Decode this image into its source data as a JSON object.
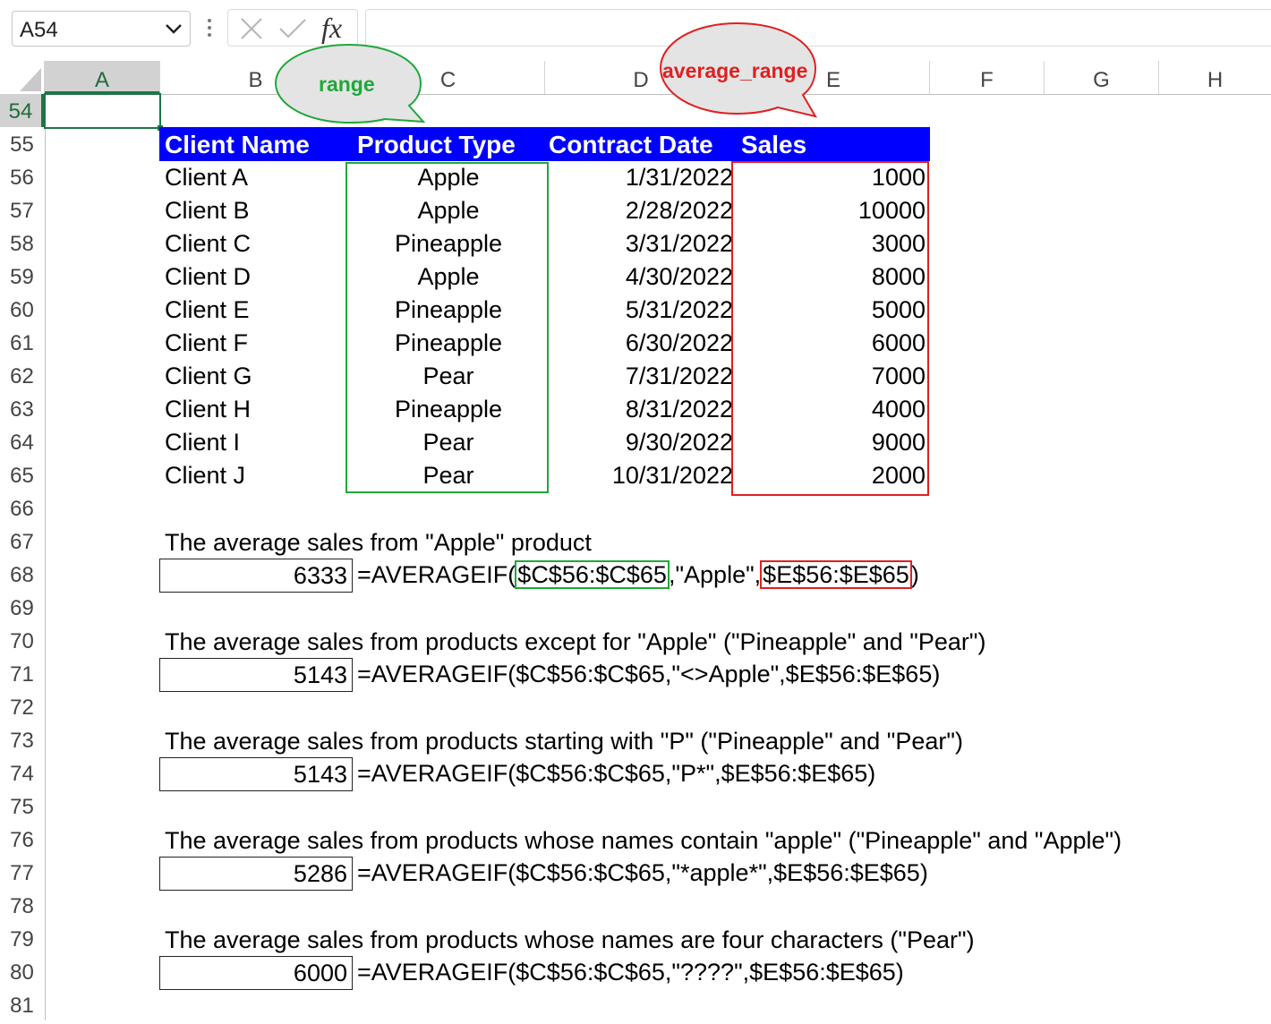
{
  "name_box": {
    "value": "A54"
  },
  "formula_bar": {
    "fx_label": "fx",
    "formula": ""
  },
  "columns": [
    "A",
    "B",
    "C",
    "D",
    "E",
    "F",
    "G",
    "H"
  ],
  "active_column": "A",
  "rows": [
    "54",
    "55",
    "56",
    "57",
    "58",
    "59",
    "60",
    "61",
    "62",
    "63",
    "64",
    "65",
    "66",
    "67",
    "68",
    "69",
    "70",
    "71",
    "72",
    "73",
    "74",
    "75",
    "76",
    "77",
    "78",
    "79",
    "80",
    "81"
  ],
  "active_row": "54",
  "table": {
    "headers": [
      "Client Name",
      "Product Type",
      "Contract Date",
      "Sales"
    ],
    "rows": [
      [
        "Client A",
        "Apple",
        "1/31/2022",
        "1000"
      ],
      [
        "Client B",
        "Apple",
        "2/28/2022",
        "10000"
      ],
      [
        "Client C",
        "Pineapple",
        "3/31/2022",
        "3000"
      ],
      [
        "Client D",
        "Apple",
        "4/30/2022",
        "8000"
      ],
      [
        "Client E",
        "Pineapple",
        "5/31/2022",
        "5000"
      ],
      [
        "Client F",
        "Pineapple",
        "6/30/2022",
        "6000"
      ],
      [
        "Client G",
        "Pear",
        "7/31/2022",
        "7000"
      ],
      [
        "Client H",
        "Pineapple",
        "8/31/2022",
        "4000"
      ],
      [
        "Client I",
        "Pear",
        "9/30/2022",
        "9000"
      ],
      [
        "Client J",
        "Pear",
        "10/31/2022",
        "2000"
      ]
    ]
  },
  "callouts": {
    "range": "range",
    "average_range": "average_range"
  },
  "examples": [
    {
      "description": "The average sales from \"Apple\" product",
      "result": "6333",
      "formula_prefix": "=AVERAGEIF(",
      "formula_range": "$C$56:$C$65",
      "formula_criteria": ",\"Apple\",",
      "formula_avg_range": "$E$56:$E$65",
      "formula_suffix": ")"
    },
    {
      "description": "The average sales from products except for \"Apple\" (\"Pineapple\" and \"Pear\")",
      "result": "5143",
      "formula": "=AVERAGEIF($C$56:$C$65,\"<>Apple\",$E$56:$E$65)"
    },
    {
      "description": "The average sales from products starting with \"P\" (\"Pineapple\" and \"Pear\")",
      "result": "5143",
      "formula": "=AVERAGEIF($C$56:$C$65,\"P*\",$E$56:$E$65)"
    },
    {
      "description": "The average sales from products whose names contain \"apple\" (\"Pineapple\" and \"Apple\")",
      "result": "5286",
      "formula": "=AVERAGEIF($C$56:$C$65,\"*apple*\",$E$56:$E$65)"
    },
    {
      "description": "The average sales from products whose names are four characters (\"Pear\")",
      "result": "6000",
      "formula": "=AVERAGEIF($C$56:$C$65,\"????\",$E$56:$E$65)"
    }
  ],
  "colors": {
    "accent_green": "#217346",
    "range_box": "#1fa83a",
    "avg_box": "#e02020",
    "header_fill": "#0000ff"
  },
  "icons": [
    "chevron-down-icon",
    "more-dots-icon",
    "cancel-x-icon",
    "confirm-check-icon",
    "fx-icon"
  ]
}
